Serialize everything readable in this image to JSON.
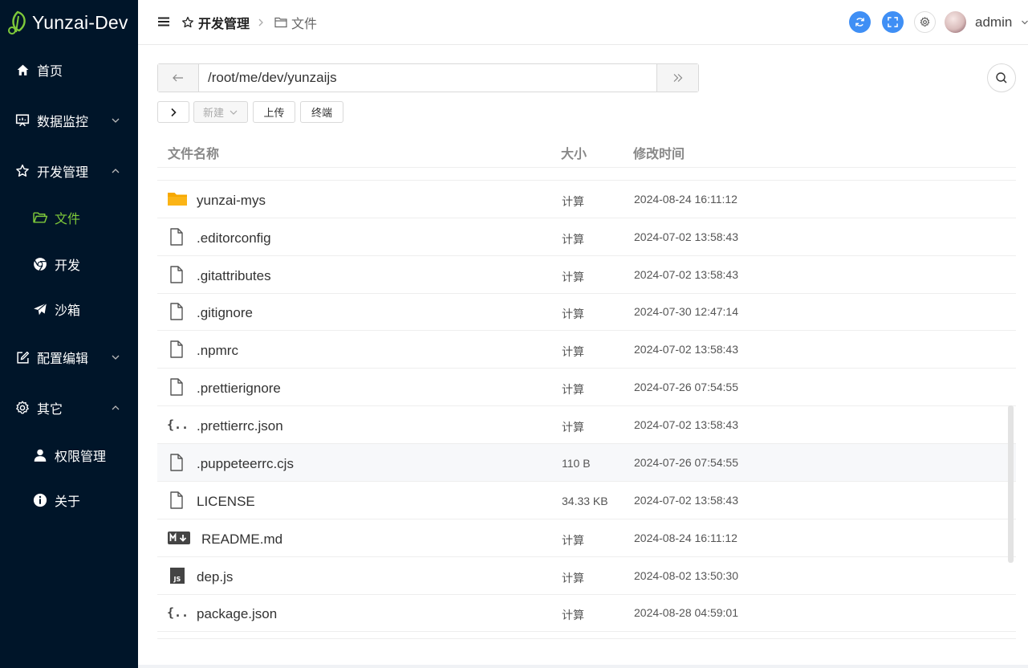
{
  "app": {
    "title": "Yunzai-Dev"
  },
  "sidebar": {
    "items": [
      {
        "label": "首页",
        "icon": "home-icon"
      },
      {
        "label": "数据监控",
        "icon": "monitor-icon",
        "expandable": true,
        "expanded": false
      },
      {
        "label": "开发管理",
        "icon": "star-icon",
        "expandable": true,
        "expanded": true
      },
      {
        "label": "文件",
        "icon": "folder-icon",
        "active": true
      },
      {
        "label": "开发",
        "icon": "chrome-icon"
      },
      {
        "label": "沙箱",
        "icon": "send-icon"
      },
      {
        "label": "配置编辑",
        "icon": "edit-icon",
        "expandable": true,
        "expanded": false
      },
      {
        "label": "其它",
        "icon": "gear-icon",
        "expandable": true,
        "expanded": true
      },
      {
        "label": "权限管理",
        "icon": "user-icon"
      },
      {
        "label": "关于",
        "icon": "info-icon"
      }
    ],
    "active_color": "#7ec93a",
    "bg_color": "#001529"
  },
  "header": {
    "breadcrumb": [
      "开发管理",
      "文件"
    ],
    "user": "admin",
    "accent_color": "#3f8ff5"
  },
  "path_bar": {
    "value": "/root/me/dev/yunzaijs"
  },
  "toolbar": {
    "new_label": "新建",
    "upload_label": "上传",
    "terminal_label": "终端"
  },
  "table": {
    "columns": [
      "文件名称",
      "大小",
      "修改时间"
    ],
    "rows": [
      {
        "name": "yunzai-mys",
        "type": "folder",
        "size": "计算",
        "time": "2024-08-24 16:11:12"
      },
      {
        "name": ".editorconfig",
        "type": "file",
        "size": "计算",
        "time": "2024-07-02 13:58:43"
      },
      {
        "name": ".gitattributes",
        "type": "file",
        "size": "计算",
        "time": "2024-07-02 13:58:43"
      },
      {
        "name": ".gitignore",
        "type": "file",
        "size": "计算",
        "time": "2024-07-30 12:47:14"
      },
      {
        "name": ".npmrc",
        "type": "file",
        "size": "计算",
        "time": "2024-07-02 13:58:43"
      },
      {
        "name": ".prettierignore",
        "type": "file",
        "size": "计算",
        "time": "2024-07-26 07:54:55"
      },
      {
        "name": ".prettierrc.json",
        "type": "json",
        "size": "计算",
        "time": "2024-07-02 13:58:43"
      },
      {
        "name": ".puppeteerrc.cjs",
        "type": "file",
        "size": "110 B",
        "time": "2024-07-26 07:54:55"
      },
      {
        "name": "LICENSE",
        "type": "file",
        "size": "34.33 KB",
        "time": "2024-07-02 13:58:43"
      },
      {
        "name": "README.md",
        "type": "markdown",
        "size": "计算",
        "time": "2024-08-24 16:11:12"
      },
      {
        "name": "dep.js",
        "type": "js",
        "size": "计算",
        "time": "2024-08-02 13:50:30"
      },
      {
        "name": "package.json",
        "type": "json",
        "size": "计算",
        "time": "2024-08-28 04:59:01"
      }
    ]
  }
}
